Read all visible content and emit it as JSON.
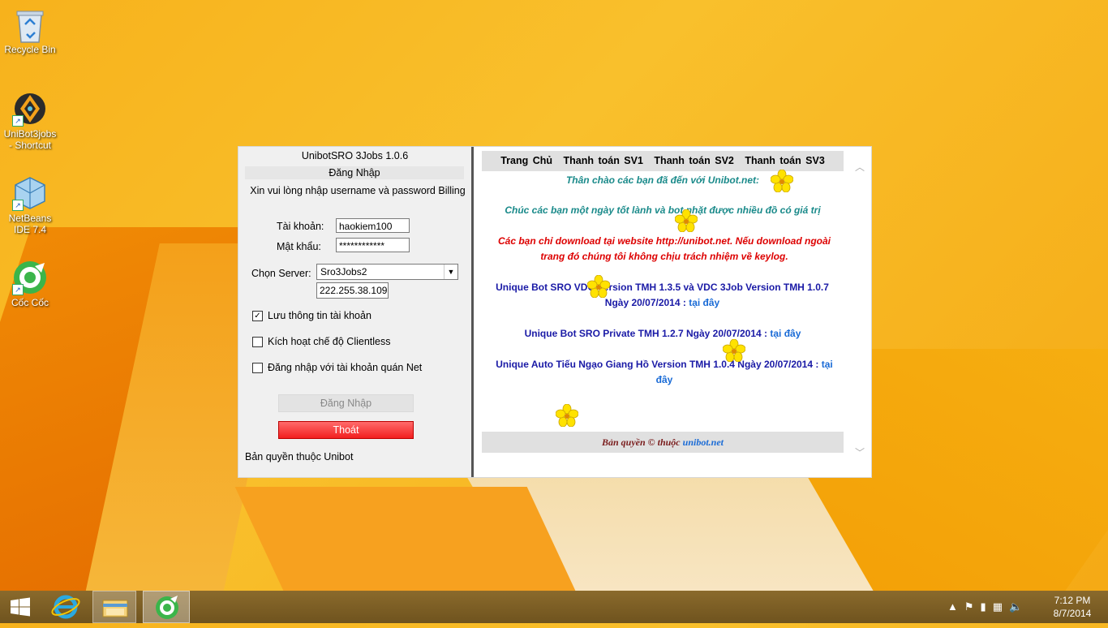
{
  "desktop": {
    "icons": [
      {
        "label": "Recycle Bin",
        "icon": "recycle-bin-icon"
      },
      {
        "label": "UniBot3jobs - Shortcut",
        "icon": "unibot-icon"
      },
      {
        "label": "NetBeans IDE 7.4",
        "icon": "netbeans-icon"
      },
      {
        "label": "Cốc Cốc",
        "icon": "coccoc-icon"
      }
    ]
  },
  "window": {
    "title": "UnibotSRO 3Jobs 1.0.6",
    "section_title": "Đăng Nhập",
    "prompt": "Xin vui lòng nhập username và password Billing",
    "account_label": "Tài khoản:",
    "account_value": "haokiem100",
    "password_label": "Mật khẩu:",
    "password_value": "************",
    "server_label": "Chọn Server:",
    "server_value": "Sro3Jobs2",
    "ip_value": "222.255.38.109",
    "checkboxes": [
      {
        "label": "Lưu thông tin tài khoản",
        "checked": "true"
      },
      {
        "label": "Kích hoạt chế độ Clientless",
        "checked": "false"
      },
      {
        "label": "Đăng nhập với tài khoản quán Net",
        "checked": "false"
      }
    ],
    "login_button": "Đăng Nhập",
    "exit_button": "Thoát",
    "left_copyright": "Bản quyền thuộc Unibot"
  },
  "web": {
    "nav": [
      "Trang Chủ",
      "Thanh toán SV1",
      "Thanh toán SV2",
      "Thanh toán SV3"
    ],
    "greeting": "Thân chào các bạn đã đến với Unibot.net:",
    "wish": "Chúc các bạn một ngày tốt lành và bot nhặt được nhiều đồ có giá trị",
    "warning": "Các bạn chỉ download tại website http://unibot.net. Nếu download ngoài trang đó chúng tôi không chịu trách nhiệm về keylog.",
    "item1_text": "Unique Bot SRO VDC Version TMH 1.3.5 và VDC 3Job Version TMH 1.0.7 Ngày 20/07/2014 :",
    "item2_text": "Unique Bot SRO Private TMH 1.2.7 Ngày 20/07/2014 :",
    "item3_text": "Unique Auto Tiếu Ngạo Giang Hồ Version TMH 1.0.4 Ngày 20/07/2014 :",
    "link_text": "tại đây",
    "footer_prefix": "Bản quyền © thuộc",
    "footer_link": "unibot.net"
  },
  "taskbar": {
    "apps": [
      "start-button",
      "internet-explorer",
      "file-explorer",
      "coccoc-browser"
    ],
    "time": "7:12 PM",
    "date": "8/7/2014"
  },
  "colors": {
    "exit_button": "#f21f1f",
    "teal_text": "#1a8a8a",
    "warning_text": "#dd0000",
    "blue_text": "#1a1aa6",
    "link": "#1a6bd6",
    "wallpaper": "#f7b21c"
  }
}
